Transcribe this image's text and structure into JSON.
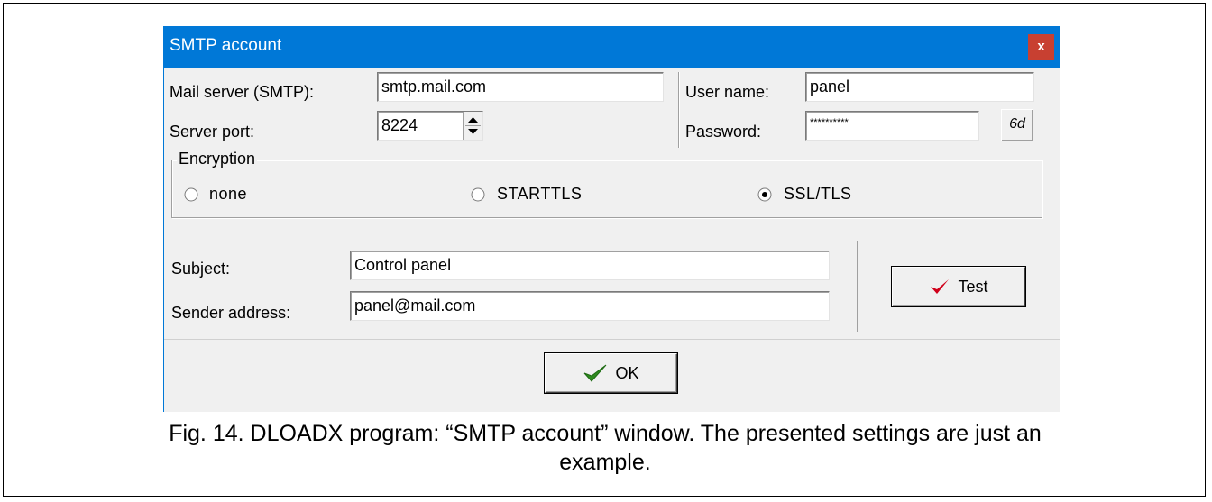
{
  "window": {
    "title": "SMTP account",
    "close_label": "x"
  },
  "server": {
    "mail_server_label": "Mail server (SMTP):",
    "mail_server_value": "smtp.mail.com",
    "port_label": "Server port:",
    "port_value": "8224"
  },
  "credentials": {
    "user_label": "User name:",
    "user_value": "panel",
    "password_label": "Password:",
    "password_value": "**********",
    "show_password_label": "6d"
  },
  "encryption": {
    "legend": "Encryption",
    "options": [
      {
        "label": "none",
        "selected": false
      },
      {
        "label": "STARTTLS",
        "selected": false
      },
      {
        "label": "SSL/TLS",
        "selected": true
      }
    ]
  },
  "message": {
    "subject_label": "Subject:",
    "subject_value": "Control panel",
    "sender_label": "Sender address:",
    "sender_value": "panel@mail.com"
  },
  "buttons": {
    "test_label": "Test",
    "ok_label": "OK"
  },
  "icons": {
    "test": "red-checkmark-icon",
    "ok": "green-checkmark-icon"
  },
  "colors": {
    "titlebar": "#0078d7",
    "close": "#c84031",
    "test_check": "#d0001a",
    "ok_check": "#2e8b1f"
  },
  "caption": {
    "line1": "Fig. 14. DLOADX program: “SMTP account” window. The presented settings are just an",
    "line2": "example."
  }
}
